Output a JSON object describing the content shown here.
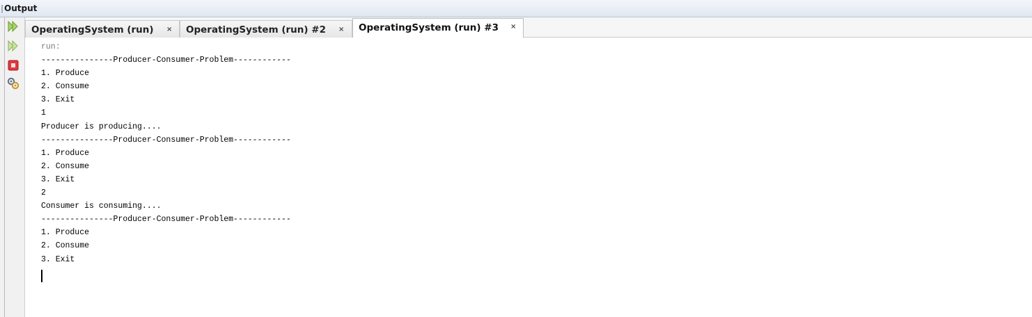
{
  "panel": {
    "title": "Output",
    "tools": [
      "rerun-icon",
      "rerun-with-args-icon",
      "stop-icon",
      "settings-icon"
    ]
  },
  "tabs": [
    {
      "label": "OperatingSystem (run)",
      "close": "×",
      "active": false
    },
    {
      "label": "OperatingSystem (run) #2",
      "close": "×",
      "active": false
    },
    {
      "label": "OperatingSystem (run) #3",
      "close": "×",
      "active": true
    }
  ],
  "console": {
    "lines": [
      "run:",
      "---------------Producer-Consumer-Problem------------",
      "1. Produce",
      "2. Consume",
      "3. Exit",
      "1",
      "Producer is producing....",
      "---------------Producer-Consumer-Problem------------",
      "1. Produce",
      "2. Consume",
      "3. Exit",
      "2",
      "Consumer is consuming....",
      "---------------Producer-Consumer-Problem------------",
      "1. Produce",
      "2. Consume",
      "3. Exit"
    ]
  },
  "colors": {
    "header_bg": "#dfe7f1",
    "stop_red": "#e0393e",
    "run_green": "#8cc63f"
  }
}
